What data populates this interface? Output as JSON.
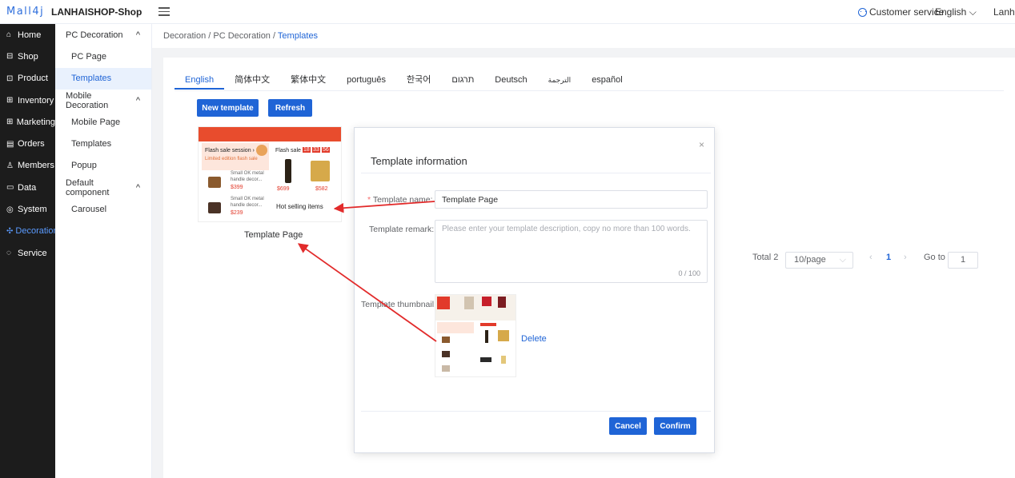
{
  "topbar": {
    "logo": "Mall4j",
    "shop": "LANHAISHOP-Shop",
    "service": "Customer service",
    "lang": "English",
    "user": "Lanha"
  },
  "sidebar": [
    {
      "icon": "home-icon",
      "glyph": "⌂",
      "label": "Home"
    },
    {
      "icon": "shop-icon",
      "glyph": "⊟",
      "label": "Shop"
    },
    {
      "icon": "product-icon",
      "glyph": "⊡",
      "label": "Product"
    },
    {
      "icon": "inventory-icon",
      "glyph": "⊞",
      "label": "Inventory"
    },
    {
      "icon": "marketing-icon",
      "glyph": "⊞",
      "label": "Marketing"
    },
    {
      "icon": "orders-icon",
      "glyph": "▤",
      "label": "Orders"
    },
    {
      "icon": "members-icon",
      "glyph": "♙",
      "label": "Members"
    },
    {
      "icon": "data-icon",
      "glyph": "▭",
      "label": "Data"
    },
    {
      "icon": "system-icon",
      "glyph": "◎",
      "label": "System"
    },
    {
      "icon": "decoration-icon",
      "glyph": "✣",
      "label": "Decoration"
    },
    {
      "icon": "service-icon",
      "glyph": "◌",
      "label": "Service"
    }
  ],
  "submenu": {
    "g1": "PC Decoration",
    "pc_page": "PC Page",
    "templates1": "Templates",
    "g2": "Mobile Decoration",
    "mobile_page": "Mobile Page",
    "templates2": "Templates",
    "popup": "Popup",
    "g3": "Default component",
    "carousel": "Carousel"
  },
  "breadcrumb": {
    "a": "Decoration",
    "b": "PC Decoration",
    "c": "Templates",
    "sep": "/"
  },
  "tabs": [
    "English",
    "简体中文",
    "繁体中文",
    "português",
    "한국어",
    "תרגום",
    "Deutsch",
    "الترجمة",
    "español"
  ],
  "buttons": {
    "new_template": "New template",
    "refresh": "Refresh"
  },
  "template_card": {
    "title": "Template Page",
    "flash_session": "Flash sale session ›",
    "limited": "Limited edition flash sale",
    "flash_sale": "Flash sale",
    "timer": [
      "18",
      "33",
      "56"
    ],
    "item": "Small OK metal",
    "item2": "handle decor...",
    "p1": "$399",
    "p2": "$239",
    "p3": "$699",
    "p4": "$582",
    "old": "$699",
    "hot": "Hot selling items"
  },
  "dialog": {
    "title": "Template information",
    "close": "×",
    "name_label": "Template name:",
    "required": "*",
    "name_value": "Template Page",
    "remark_label": "Template remark:",
    "remark_placeholder": "Please enter your template description, copy no more than 100 words.",
    "remark_count": "0 / 100",
    "thumb_label": "Template thumbnail:",
    "delete": "Delete",
    "cancel": "Cancel",
    "confirm": "Confirm"
  },
  "pagination": {
    "total": "Total 2",
    "per_page": "10/page",
    "page": "1",
    "goto": "Go to",
    "goto_value": "1",
    "prev": "‹",
    "next": "›"
  },
  "colors": {
    "accent": "#1f64d6",
    "sidebar": "#1c1c1c",
    "arrow": "#e22b2b",
    "flash": "#e84c2d"
  }
}
